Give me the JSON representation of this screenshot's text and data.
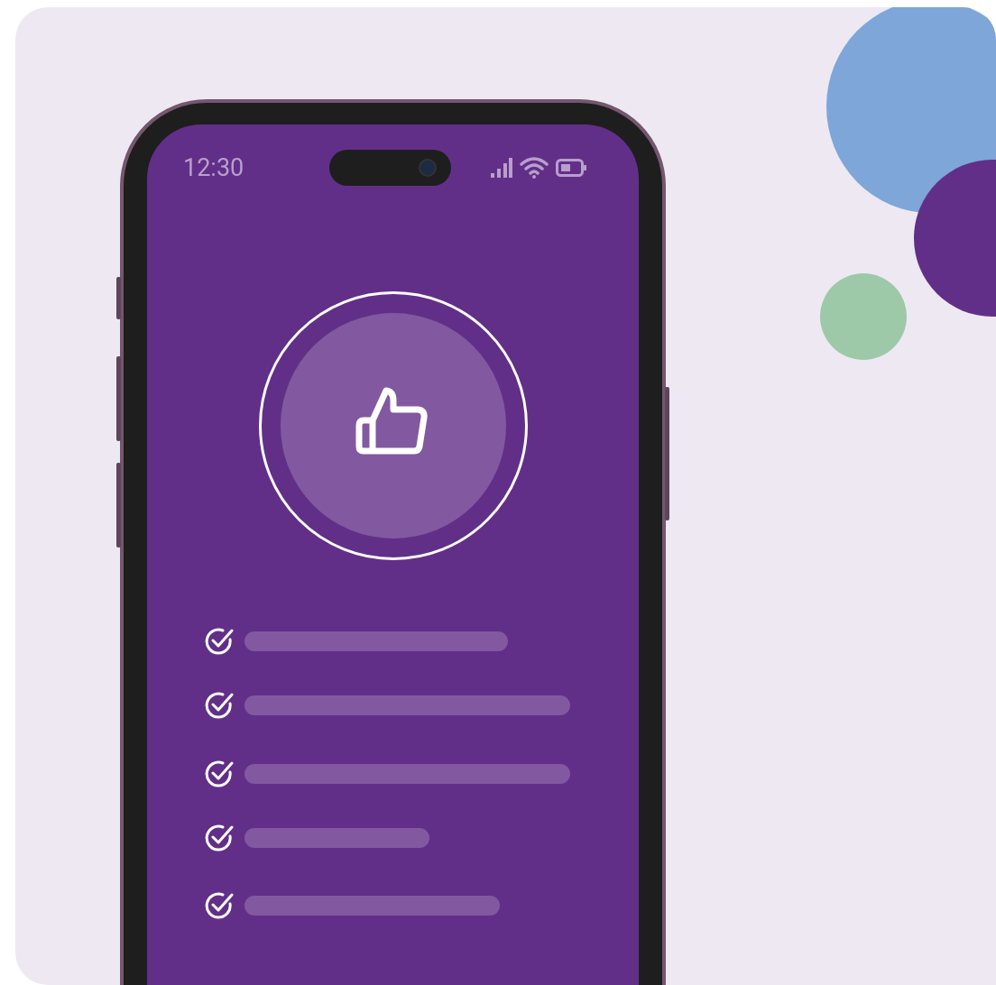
{
  "phone": {
    "status_bar": {
      "time": "12:30"
    },
    "checklist": [
      {
        "checked": true
      },
      {
        "checked": true
      },
      {
        "checked": true
      },
      {
        "checked": true
      },
      {
        "checked": true
      }
    ]
  }
}
